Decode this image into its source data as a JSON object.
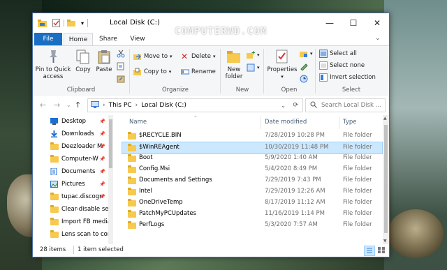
{
  "watermark": "COMPUTERWD.COM",
  "window": {
    "title": "Local Disk (C:)",
    "controls": [
      "minimize",
      "maximize",
      "close"
    ]
  },
  "ribbon_tabs": [
    "File",
    "Home",
    "Share",
    "View"
  ],
  "ribbon": {
    "clipboard": {
      "label": "Clipboard",
      "pin": "Pin to Quick access",
      "copy": "Copy",
      "paste": "Paste"
    },
    "organize": {
      "label": "Organize",
      "move_to": "Move to",
      "copy_to": "Copy to",
      "delete": "Delete",
      "rename": "Rename"
    },
    "new": {
      "label": "New",
      "new_folder": "New folder"
    },
    "open": {
      "label": "Open",
      "properties": "Properties"
    },
    "select": {
      "label": "Select",
      "select_all": "Select all",
      "select_none": "Select none",
      "invert": "Invert selection"
    }
  },
  "address": {
    "crumbs": [
      "This PC",
      "Local Disk (C:)"
    ],
    "search_placeholder": "Search Local Disk ..."
  },
  "nav_items": [
    {
      "label": "Desktop",
      "icon": "desktop-icon",
      "pinned": true
    },
    {
      "label": "Downloads",
      "icon": "download-icon",
      "pinned": true
    },
    {
      "label": "Deezloader M",
      "icon": "folder-icon",
      "pinned": true
    },
    {
      "label": "Computer-W",
      "icon": "folder-icon",
      "pinned": true
    },
    {
      "label": "Documents",
      "icon": "documents-icon",
      "pinned": true
    },
    {
      "label": "Pictures",
      "icon": "pictures-icon",
      "pinned": true
    },
    {
      "label": "tupac.discogr",
      "icon": "folder-icon",
      "pinned": true
    },
    {
      "label": "Clear-disable sea",
      "icon": "folder-icon",
      "pinned": false
    },
    {
      "label": "Import FB media",
      "icon": "folder-icon",
      "pinned": false
    },
    {
      "label": "Lens scan to cor",
      "icon": "folder-icon",
      "pinned": false
    }
  ],
  "columns": {
    "name": "Name",
    "date": "Date modified",
    "type": "Type"
  },
  "files": [
    {
      "name": "$RECYCLE.BIN",
      "date": "7/28/2019 10:28 PM",
      "type": "File folder",
      "selected": false
    },
    {
      "name": "$WinREAgent",
      "date": "10/30/2019 11:48 PM",
      "type": "File folder",
      "selected": true
    },
    {
      "name": "Boot",
      "date": "5/9/2020 1:40 AM",
      "type": "File folder",
      "selected": false
    },
    {
      "name": "Config.Msi",
      "date": "5/4/2020 8:49 PM",
      "type": "File folder",
      "selected": false
    },
    {
      "name": "Documents and Settings",
      "date": "7/29/2019 7:43 PM",
      "type": "File folder",
      "selected": false
    },
    {
      "name": "Intel",
      "date": "7/29/2019 12:26 AM",
      "type": "File folder",
      "selected": false
    },
    {
      "name": "OneDriveTemp",
      "date": "8/17/2019 11:12 AM",
      "type": "File folder",
      "selected": false
    },
    {
      "name": "PatchMyPCUpdates",
      "date": "11/16/2019 1:14 PM",
      "type": "File folder",
      "selected": false
    },
    {
      "name": "PerfLogs",
      "date": "5/3/2020 7:57 AM",
      "type": "File folder",
      "selected": false
    }
  ],
  "status": {
    "count": "28 items",
    "selected": "1 item selected"
  },
  "colors": {
    "accent": "#1a6fc4",
    "selection": "#cce8ff",
    "folder": "#f6c94f"
  }
}
